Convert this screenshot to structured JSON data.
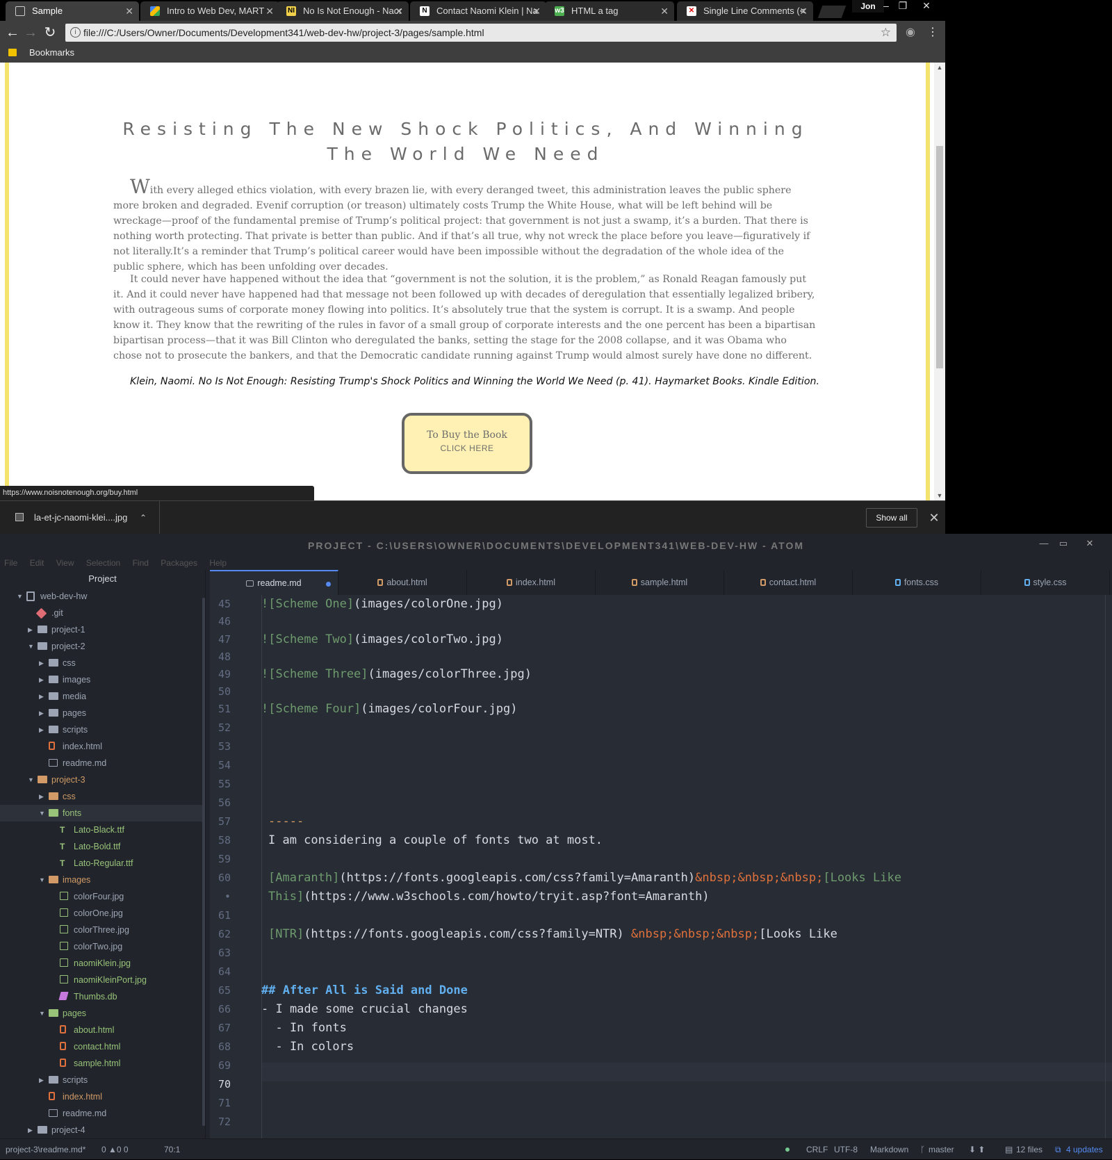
{
  "browser": {
    "tabs": [
      {
        "title": "Sample",
        "icon": "page-icon",
        "active": true
      },
      {
        "title": "Intro to Web Dev, MART",
        "icon": "drive-icon"
      },
      {
        "title": "No Is Not Enough - Naor",
        "icon": "nine-icon"
      },
      {
        "title": "Contact Naomi Klein | Na",
        "icon": "n-logo-icon"
      },
      {
        "title": "HTML a tag",
        "icon": "w3-icon"
      },
      {
        "title": "Single Line Comments (<",
        "icon": "x-logo-icon"
      }
    ],
    "profile": "Jon",
    "url": "file:///C:/Users/Owner/Documents/Development341/web-dev-hw/project-3/pages/sample.html",
    "bookmarks_label": "Bookmarks",
    "status_url": "https://www.noisnotenough.org/buy.html",
    "download": {
      "filename": "la-et-jc-naomi-klei....jpg",
      "show_all": "Show all"
    }
  },
  "page": {
    "title": "Resisting The New Shock Politics, And Winning The World We Need",
    "para1_dropcap": "W",
    "para1": "ith every alleged ethics violation, with every brazen lie, with every deranged tweet, this administration leaves the public sphere more broken and degraded. Evenif corruption (or treason) ultimately costs Trump the White House, what will be left behind will be wreckage—proof of the fundamental premise of Trump’s political project: that government is not just a swamp, it’s a burden. That there is nothing worth protecting. That private is better than public. And if that’s all true, why not wreck the place before you leave—figuratively if not literally.It’s a reminder that Trump’s political career would have been impossible without the degradation of the whole idea of the public sphere, which has been unfolding over decades.",
    "para2": "It could never have happened without the idea that “government is not the solution, it is the problem,” as Ronald Reagan famously put it. And it could never have happened had that message not been followed up with decades of deregulation that essentially legalized bribery, with outrageous sums of corporate money flowing into politics. It’s absolutely true that the system is corrupt. It is a swamp. And people know it. They know that the rewriting of the rules in favor of a small group of corporate interests and the one percent has been a bipartisan bipartisan process—that it was Bill Clinton who deregulated the banks, setting the stage for the 2008 collapse, and it was Obama who chose not to prosecute the bankers, and that the Democratic candidate running against Trump would almost surely have done no different.",
    "citation": "Klein, Naomi. No Is Not Enough: Resisting Trump's Shock Politics and Winning the World We Need (p. 41). Haymarket Books. Kindle Edition.",
    "buy_line1": "To Buy the Book",
    "buy_line2": "CLICK HERE"
  },
  "atom": {
    "window_title": "PROJECT - C:\\USERS\\OWNER\\DOCUMENTS\\DEVELOPMENT341\\WEB-DEV-HW - ATOM",
    "menu": [
      "File",
      "Edit",
      "View",
      "Selection",
      "Find",
      "Packages",
      "Help"
    ],
    "tree_header": "Project",
    "tree": [
      {
        "label": "web-dev-hw",
        "depth": 0,
        "kind": "repo",
        "open": true
      },
      {
        "label": ".git",
        "depth": 1,
        "kind": "git",
        "open": false
      },
      {
        "label": "project-1",
        "depth": 1,
        "kind": "folder",
        "open": false
      },
      {
        "label": "project-2",
        "depth": 1,
        "kind": "folder",
        "open": true
      },
      {
        "label": "css",
        "depth": 2,
        "kind": "folder",
        "open": false
      },
      {
        "label": "images",
        "depth": 2,
        "kind": "folder",
        "open": false
      },
      {
        "label": "media",
        "depth": 2,
        "kind": "folder",
        "open": false
      },
      {
        "label": "pages",
        "depth": 2,
        "kind": "folder",
        "open": false
      },
      {
        "label": "scripts",
        "depth": 2,
        "kind": "folder",
        "open": false
      },
      {
        "label": "index.html",
        "depth": 2,
        "kind": "html"
      },
      {
        "label": "readme.md",
        "depth": 2,
        "kind": "md"
      },
      {
        "label": "project-3",
        "depth": 1,
        "kind": "folder",
        "open": true,
        "color": "orange"
      },
      {
        "label": "css",
        "depth": 2,
        "kind": "folder",
        "open": false,
        "color": "orange"
      },
      {
        "label": "fonts",
        "depth": 2,
        "kind": "folder",
        "open": true,
        "color": "green",
        "selected": true
      },
      {
        "label": "Lato-Black.ttf",
        "depth": 3,
        "kind": "font",
        "color": "green"
      },
      {
        "label": "Lato-Bold.ttf",
        "depth": 3,
        "kind": "font",
        "color": "green"
      },
      {
        "label": "Lato-Regular.ttf",
        "depth": 3,
        "kind": "font",
        "color": "green"
      },
      {
        "label": "images",
        "depth": 2,
        "kind": "folder",
        "open": true,
        "color": "orange"
      },
      {
        "label": "colorFour.jpg",
        "depth": 3,
        "kind": "img"
      },
      {
        "label": "colorOne.jpg",
        "depth": 3,
        "kind": "img"
      },
      {
        "label": "colorThree.jpg",
        "depth": 3,
        "kind": "img"
      },
      {
        "label": "colorTwo.jpg",
        "depth": 3,
        "kind": "img"
      },
      {
        "label": "naomiKlein.jpg",
        "depth": 3,
        "kind": "img",
        "color": "green"
      },
      {
        "label": "naomiKleinPort.jpg",
        "depth": 3,
        "kind": "img",
        "color": "green"
      },
      {
        "label": "Thumbs.db",
        "depth": 3,
        "kind": "db",
        "color": "green"
      },
      {
        "label": "pages",
        "depth": 2,
        "kind": "folder",
        "open": true,
        "color": "green"
      },
      {
        "label": "about.html",
        "depth": 3,
        "kind": "html",
        "color": "green"
      },
      {
        "label": "contact.html",
        "depth": 3,
        "kind": "html",
        "color": "green"
      },
      {
        "label": "sample.html",
        "depth": 3,
        "kind": "html",
        "color": "green"
      },
      {
        "label": "scripts",
        "depth": 2,
        "kind": "folder",
        "open": false
      },
      {
        "label": "index.html",
        "depth": 2,
        "kind": "html",
        "color": "orange"
      },
      {
        "label": "readme.md",
        "depth": 2,
        "kind": "md"
      },
      {
        "label": "project-4",
        "depth": 1,
        "kind": "folder",
        "open": false
      }
    ],
    "tabs": [
      {
        "label": "readme.md",
        "kind": "md",
        "active": true,
        "modified": true
      },
      {
        "label": "about.html",
        "kind": "html"
      },
      {
        "label": "index.html",
        "kind": "html"
      },
      {
        "label": "sample.html",
        "kind": "html"
      },
      {
        "label": "contact.html",
        "kind": "html"
      },
      {
        "label": "fonts.css",
        "kind": "css"
      },
      {
        "label": "style.css",
        "kind": "css"
      }
    ],
    "gutter": [
      "45",
      "46",
      "47",
      "48",
      "49",
      "50",
      "51",
      "52",
      "53",
      "54",
      "55",
      "56",
      "57",
      "58",
      "59",
      "60",
      "•",
      "61",
      "62",
      "63",
      "64",
      "65",
      "66",
      "67",
      "68",
      "69",
      "70",
      "71",
      "72"
    ],
    "current_line": "70",
    "code": {
      "l45_link": "![Scheme One]",
      "l45_url": "(images/colorOne.jpg)",
      "l47_link": "![Scheme Two]",
      "l47_url": "(images/colorTwo.jpg)",
      "l49_link": "![Scheme Three]",
      "l49_url": "(images/colorThree.jpg)",
      "l51_link": "![Scheme Four]",
      "l51_url": "(images/colorFour.jpg)",
      "l57": "-----",
      "l58": "I am considering a couple of fonts two at most.",
      "l60_link": "[Amaranth]",
      "l60_url": "(https://fonts.googleapis.com/css?family=Amaranth)",
      "l60_ent": "&nbsp;&nbsp;&nbsp;",
      "l60_link2": "[Looks Like",
      "l60b_link": "This]",
      "l60b_url": "(https://www.w3schools.com/howto/tryit.asp?font=Amaranth)",
      "l62_link": "[NTR]",
      "l62_url": "(https://fonts.googleapis.com/css?family=NTR) ",
      "l62_ent": "&nbsp;&nbsp;&nbsp;",
      "l62_rest": "[Looks Like",
      "l65": "## After All is Said and Done",
      "l66": "- I made some crucial changes",
      "l67": "  - In fonts",
      "l68": "  - In colors"
    },
    "status": {
      "file": "project-3\\readme.md*",
      "diag": "0 ▲0 0",
      "cursor": "70:1",
      "line_ending": "CRLF",
      "encoding": "UTF-8",
      "grammar": "Markdown",
      "branch": "master",
      "files": "12 files",
      "updates": "4 updates"
    }
  }
}
